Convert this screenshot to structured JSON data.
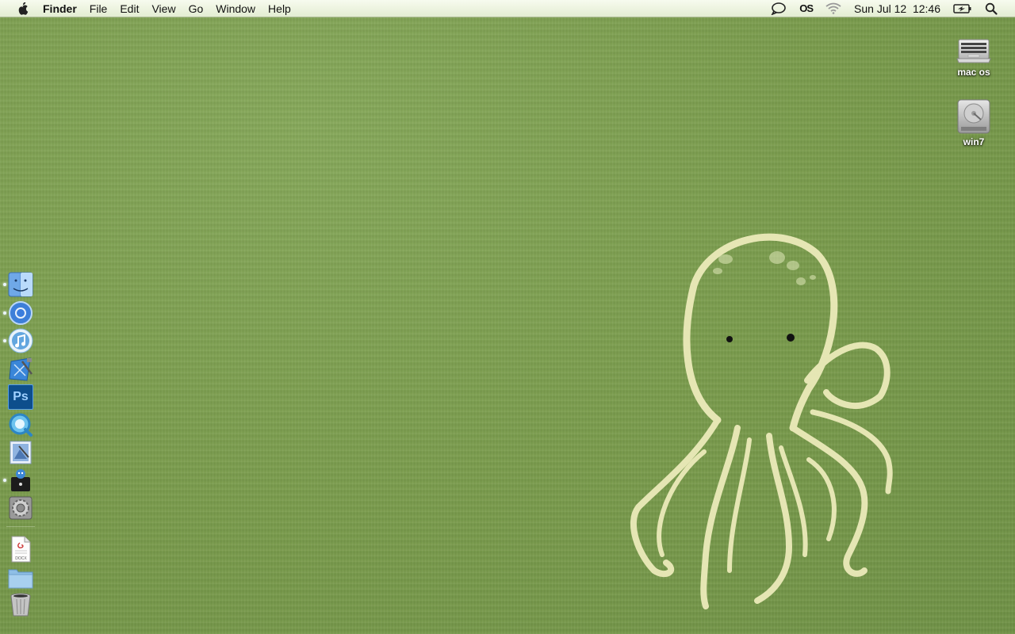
{
  "menubar": {
    "apple_icon": "apple-logo-icon",
    "app_name": "Finder",
    "menus": [
      "File",
      "Edit",
      "View",
      "Go",
      "Window",
      "Help"
    ],
    "status": {
      "chat_icon": "speech-bubble-icon",
      "lastfm_text": "OS",
      "wifi_icon": "wifi-icon",
      "datetime": "Sun Jul 12  12:46",
      "battery_icon": "battery-charging-icon",
      "spotlight_icon": "magnifier-icon"
    }
  },
  "desktop_icons": [
    {
      "label": "mac os",
      "icon": "laptop-drive-icon"
    },
    {
      "label": "win7",
      "icon": "hard-drive-icon"
    }
  ],
  "dock": {
    "items": [
      {
        "name": "Finder",
        "icon": "finder-icon",
        "running": true
      },
      {
        "name": "Chrome",
        "icon": "chrome-icon",
        "running": true
      },
      {
        "name": "iTunes",
        "icon": "itunes-icon",
        "running": true
      },
      {
        "name": "Xcode",
        "icon": "xcode-icon",
        "running": false
      },
      {
        "name": "Photoshop",
        "icon": "photoshop-icon",
        "running": false,
        "text": "Ps"
      },
      {
        "name": "QuickTime",
        "icon": "quicktime-icon",
        "running": false
      },
      {
        "name": "Preview",
        "icon": "preview-icon",
        "running": false
      },
      {
        "name": "Tweetie",
        "icon": "bird-app-icon",
        "running": true
      },
      {
        "name": "System Preferences",
        "icon": "system-preferences-icon",
        "running": false
      }
    ],
    "stacks": [
      {
        "name": "Documents",
        "icon": "document-stack-icon",
        "text": "DOCX"
      },
      {
        "name": "Folder",
        "icon": "folder-icon"
      },
      {
        "name": "Trash",
        "icon": "trash-icon"
      }
    ]
  },
  "colors": {
    "wallpaper": "#7a9c4e",
    "octopus_line": "#f1efbf",
    "menubar": "#eef5e2"
  }
}
